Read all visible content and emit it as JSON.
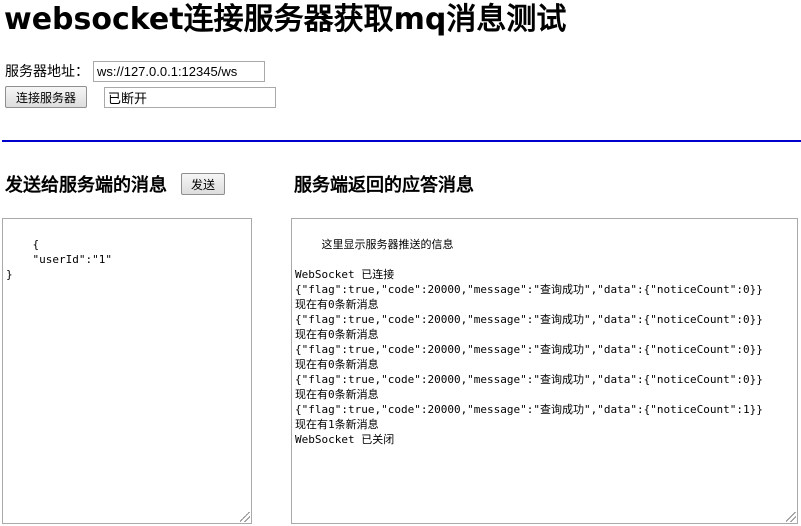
{
  "page": {
    "title": "websocket连接服务器获取mq消息测试"
  },
  "server": {
    "label": "服务器地址：",
    "url": "ws://127.0.0.1:12345/ws",
    "connect_label": "连接服务器",
    "status": "已断开"
  },
  "send": {
    "title": "发送给服务端的消息",
    "button_label": "发送",
    "message": "{\n    \"userId\":\"1\"\n}"
  },
  "receive": {
    "title": "服务端返回的应答消息",
    "log": "这里显示服务器推送的信息\n\nWebSocket 已连接\n{\"flag\":true,\"code\":20000,\"message\":\"查询成功\",\"data\":{\"noticeCount\":0}}\n现在有0条新消息\n{\"flag\":true,\"code\":20000,\"message\":\"查询成功\",\"data\":{\"noticeCount\":0}}\n现在有0条新消息\n{\"flag\":true,\"code\":20000,\"message\":\"查询成功\",\"data\":{\"noticeCount\":0}}\n现在有0条新消息\n{\"flag\":true,\"code\":20000,\"message\":\"查询成功\",\"data\":{\"noticeCount\":0}}\n现在有0条新消息\n{\"flag\":true,\"code\":20000,\"message\":\"查询成功\",\"data\":{\"noticeCount\":1}}\n现在有1条新消息\nWebSocket 已关闭"
  },
  "colors": {
    "divider": "#0000cc"
  }
}
